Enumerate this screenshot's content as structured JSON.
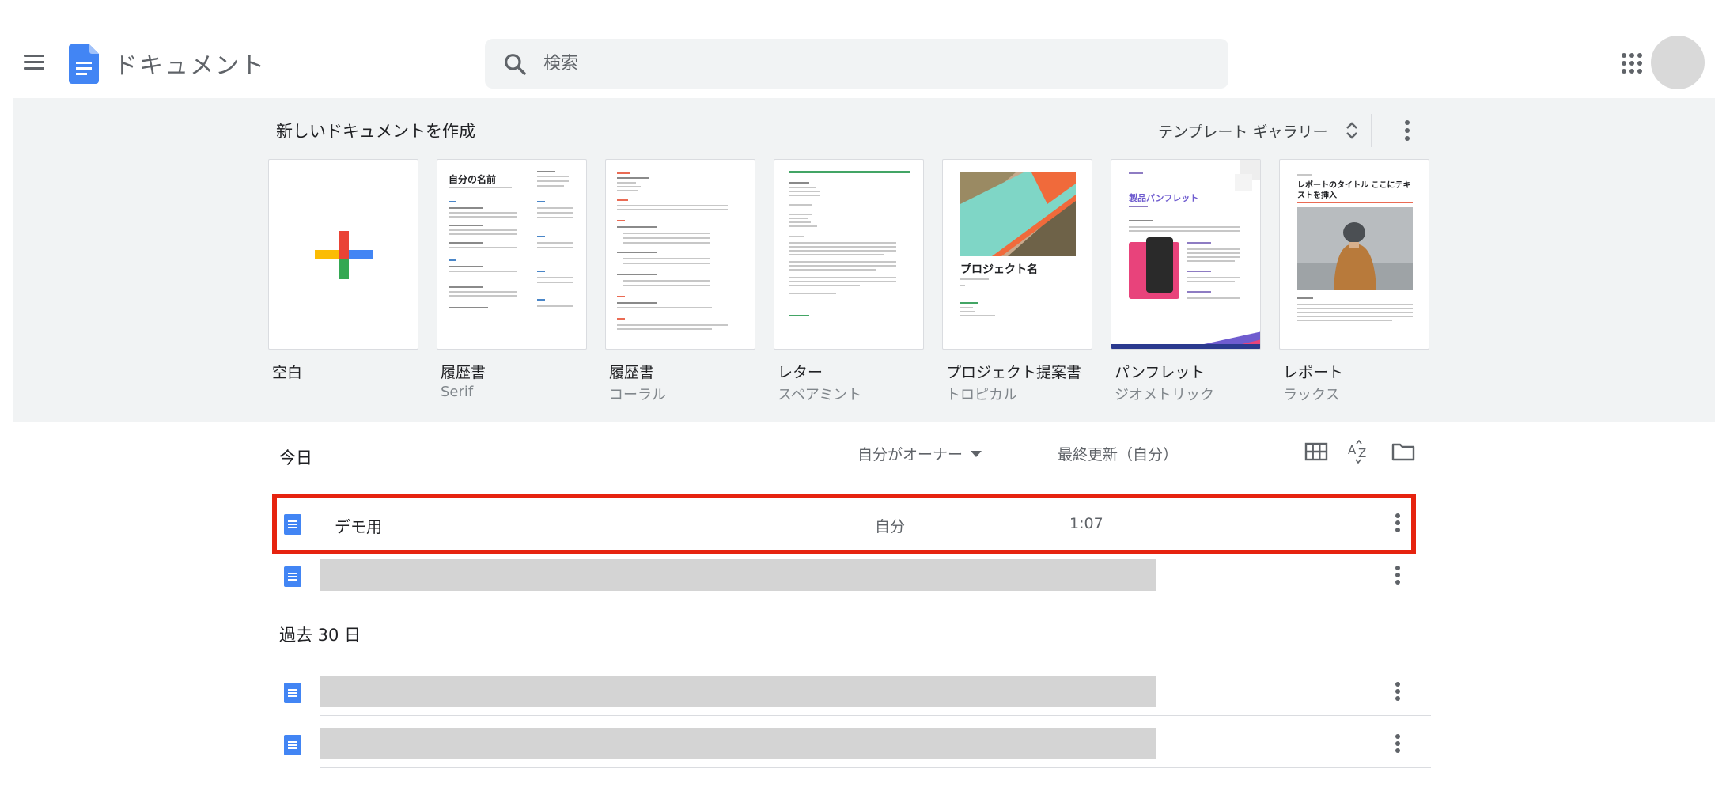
{
  "header": {
    "app_title": "ドキュメント",
    "search_placeholder": "検索",
    "icons": {
      "menu": "hamburger-menu-icon",
      "logo": "google-docs-logo",
      "search": "magnifier-icon",
      "apps": "nine-dot-grid-icon"
    }
  },
  "gallery": {
    "title": "新しいドキュメントを作成",
    "toggle_label": "テンプレート ギャラリー",
    "templates": [
      {
        "name": "空白",
        "sub": ""
      },
      {
        "name": "履歴書",
        "sub": "Serif",
        "thumb_title": "自分の名前"
      },
      {
        "name": "履歴書",
        "sub": "コーラル"
      },
      {
        "name": "レター",
        "sub": "スペアミント"
      },
      {
        "name": "プロジェクト提案書",
        "sub": "トロピカル",
        "thumb_title": "プロジェクト名"
      },
      {
        "name": "パンフレット",
        "sub": "ジオメトリック",
        "thumb_title": "製品パンフレット"
      },
      {
        "name": "レポート",
        "sub": "ラックス",
        "thumb_title": "レポートのタイトル ここにテキストを挿入"
      }
    ]
  },
  "list": {
    "columns": {
      "owner_filter": "自分がオーナー",
      "last_modified": "最終更新（自分）"
    },
    "sections": [
      {
        "label": "今日",
        "rows": [
          {
            "name": "デモ用",
            "owner": "自分",
            "time": "1:07",
            "highlighted": true
          },
          {
            "name": "",
            "owner": "",
            "time": "",
            "redacted": true
          }
        ]
      },
      {
        "label": "過去 30 日",
        "rows": [
          {
            "name": "",
            "owner": "",
            "time": "",
            "redacted": true
          },
          {
            "name": "",
            "owner": "",
            "time": "",
            "redacted": true
          }
        ]
      }
    ]
  },
  "colors": {
    "docs_blue": "#4285f4",
    "highlight_red": "#e6230f",
    "gallery_bg": "#f1f3f4",
    "redaction_gray": "#d4d4d4"
  }
}
